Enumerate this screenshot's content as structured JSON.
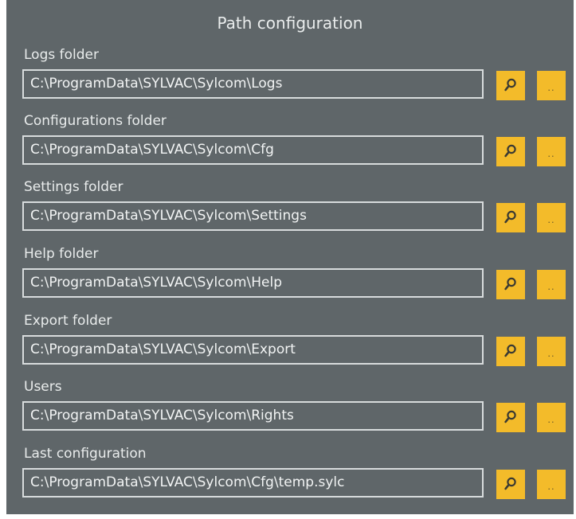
{
  "panel": {
    "title": "Path configuration"
  },
  "fields": [
    {
      "label": "Logs folder",
      "value": "C:\\ProgramData\\SYLVAC\\Sylcom\\Logs"
    },
    {
      "label": "Configurations folder",
      "value": "C:\\ProgramData\\SYLVAC\\Sylcom\\Cfg"
    },
    {
      "label": "Settings folder",
      "value": "C:\\ProgramData\\SYLVAC\\Sylcom\\Settings"
    },
    {
      "label": "Help folder",
      "value": "C:\\ProgramData\\SYLVAC\\Sylcom\\Help"
    },
    {
      "label": "Export folder",
      "value": "C:\\ProgramData\\SYLVAC\\Sylcom\\Export"
    },
    {
      "label": "Users",
      "value": "C:\\ProgramData\\SYLVAC\\Sylcom\\Rights"
    },
    {
      "label": "Last configuration",
      "value": "C:\\ProgramData\\SYLVAC\\Sylcom\\Cfg\\temp.sylc"
    }
  ],
  "buttons": {
    "search_icon": "search-icon",
    "more_label": ".."
  },
  "colors": {
    "panel_background": "#5f6669",
    "button_accent": "#f3bb2a",
    "text": "#e9ecec",
    "field_border": "#d8dcdd"
  }
}
